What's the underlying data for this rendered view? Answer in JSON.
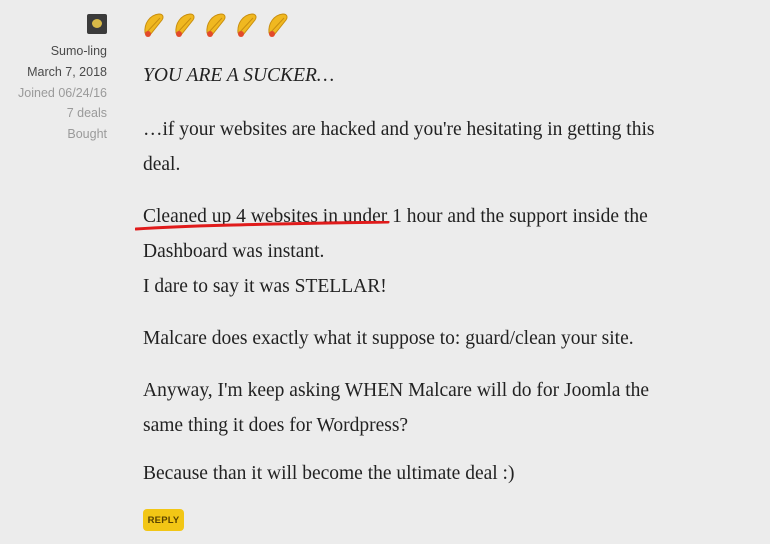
{
  "author": {
    "avatar_icon": "avatar-icon",
    "username": "Sumo-ling",
    "post_date": "March 7, 2018",
    "joined": "Joined 06/24/16",
    "deals": "7 deals",
    "bought": "Bought"
  },
  "rating": {
    "value": 5,
    "max": 5,
    "icon": "taco-icon",
    "colors": {
      "taco_shell": "#f0b820",
      "taco_filling": "#e24a2b"
    }
  },
  "review": {
    "headline": "YOU ARE A SUCKER…",
    "lines": [
      "…if your websites are hacked and you're hesitating in getting this",
      "deal.",
      "Cleaned up 4 websites in under 1 hour and the support inside the",
      "Dashboard was instant.",
      "I dare to say it was STELLAR!",
      "Malcare does exactly what it suppose to: guard/clean your site.",
      "Anyway, I'm keep asking WHEN Malcare will do for Joomla the",
      "same thing it does for Wordpress?",
      "Because than it will become the ultimate deal :)"
    ],
    "highlight_color": "#e01b1b"
  },
  "actions": {
    "reply_label": "REPLY",
    "reply_color": "#f2c615"
  }
}
